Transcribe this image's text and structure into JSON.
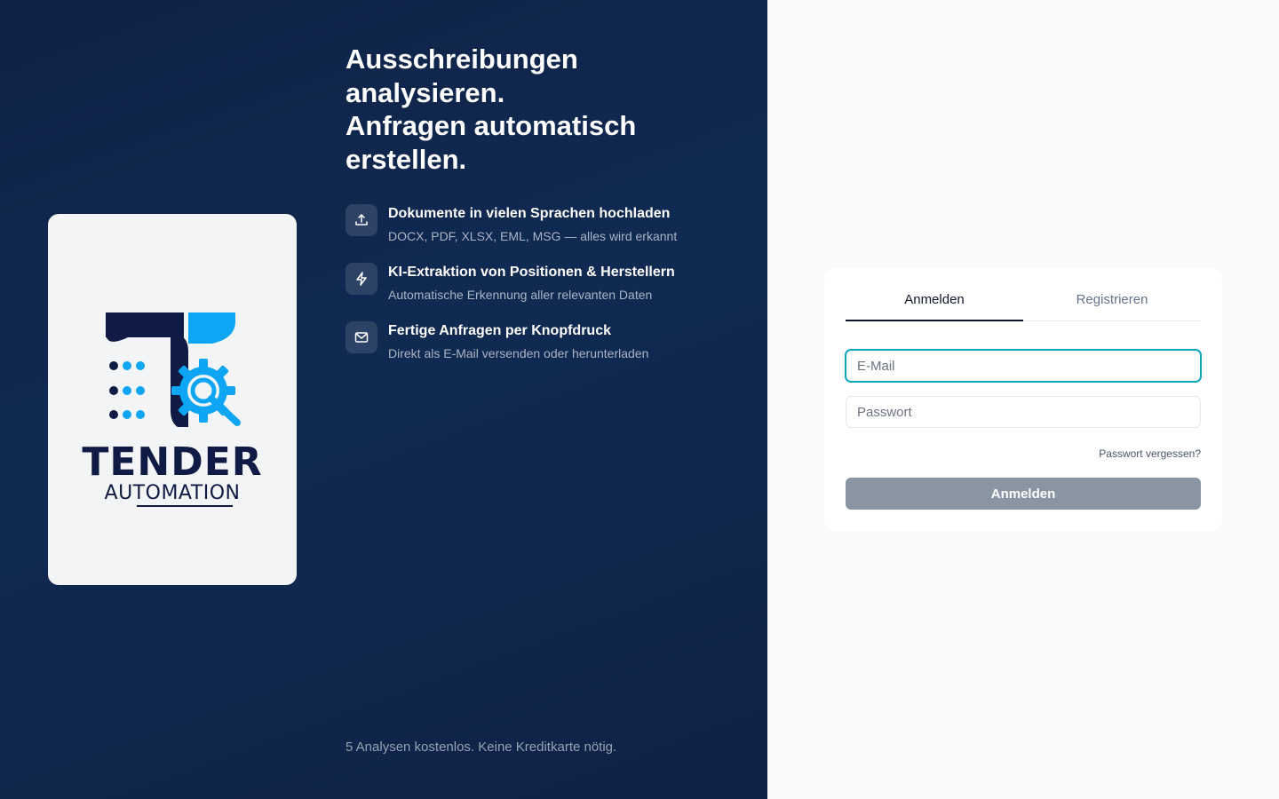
{
  "brand": {
    "word_main": "TENDER",
    "word_sub": "AUTOMATION",
    "colors": {
      "navy": "#0f1b44",
      "blue": "#0ea5f4"
    }
  },
  "hero": {
    "headline_lines": [
      "Ausschreibungen",
      "analysieren.",
      "Anfragen automatisch",
      "erstellen."
    ],
    "features": [
      {
        "icon": "upload-icon",
        "title": "Dokumente in vielen Sprachen hochladen",
        "desc": "DOCX, PDF, XLSX, EML, MSG — alles wird erkannt"
      },
      {
        "icon": "lightning-icon",
        "title": "KI-Extraktion von Positionen & Herstellern",
        "desc": "Automatische Erkennung aller relevanten Daten"
      },
      {
        "icon": "mail-icon",
        "title": "Fertige Anfragen per Knopfdruck",
        "desc": "Direkt als E-Mail versenden oder herunterladen"
      }
    ],
    "footnote": "5 Analysen kostenlos. Keine Kreditkarte nötig."
  },
  "auth": {
    "tabs": [
      "Anmelden",
      "Registrieren"
    ],
    "active_tab": "Anmelden",
    "email": {
      "placeholder": "E-Mail",
      "value": ""
    },
    "password": {
      "placeholder": "Passwort",
      "value": ""
    },
    "forgot_label": "Passwort vergessen?",
    "submit_label": "Anmelden",
    "colors": {
      "focus": "#0ea5c6",
      "button_disabled": "#8a95a3"
    }
  }
}
